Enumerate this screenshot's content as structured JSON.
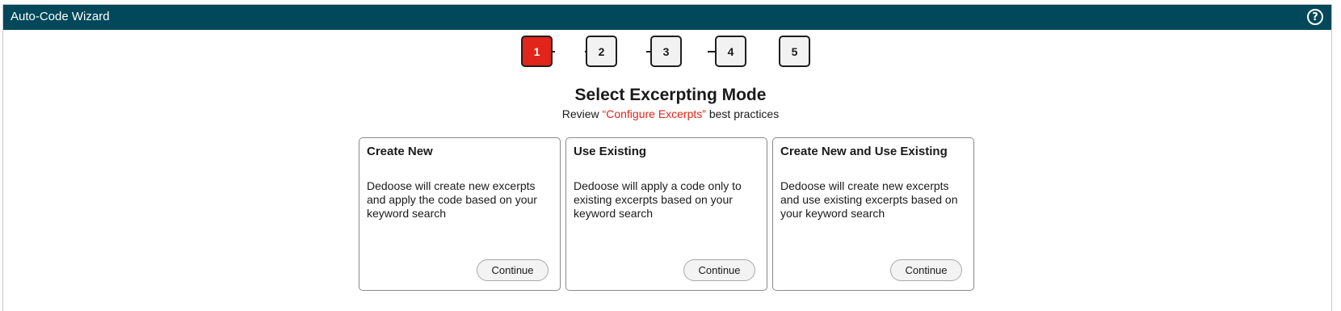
{
  "window": {
    "title": "Auto-Code Wizard",
    "help_icon": "question-circle-icon"
  },
  "stepper": {
    "steps": [
      "1",
      "2",
      "3",
      "4",
      "5"
    ],
    "active_step": "1",
    "active_color": "#e0251b"
  },
  "header": {
    "heading": "Select Excerpting Mode",
    "review_prefix": "Review",
    "review_link": "“Configure Excerpts”",
    "review_suffix": "best practices"
  },
  "cards": [
    {
      "title": "Create New",
      "description": "Dedoose will create new excerpts and apply the code based on your keyword search",
      "button_label": "Continue"
    },
    {
      "title": "Use Existing",
      "description": "Dedoose will apply a code only to existing excerpts based on your keyword search",
      "button_label": "Continue"
    },
    {
      "title": "Create New and Use Existing",
      "description": "Dedoose will create new excerpts and use existing excerpts based on your keyword search",
      "button_label": "Continue"
    }
  ],
  "colors": {
    "titlebar": "#00485a",
    "accent": "#e0251b"
  }
}
